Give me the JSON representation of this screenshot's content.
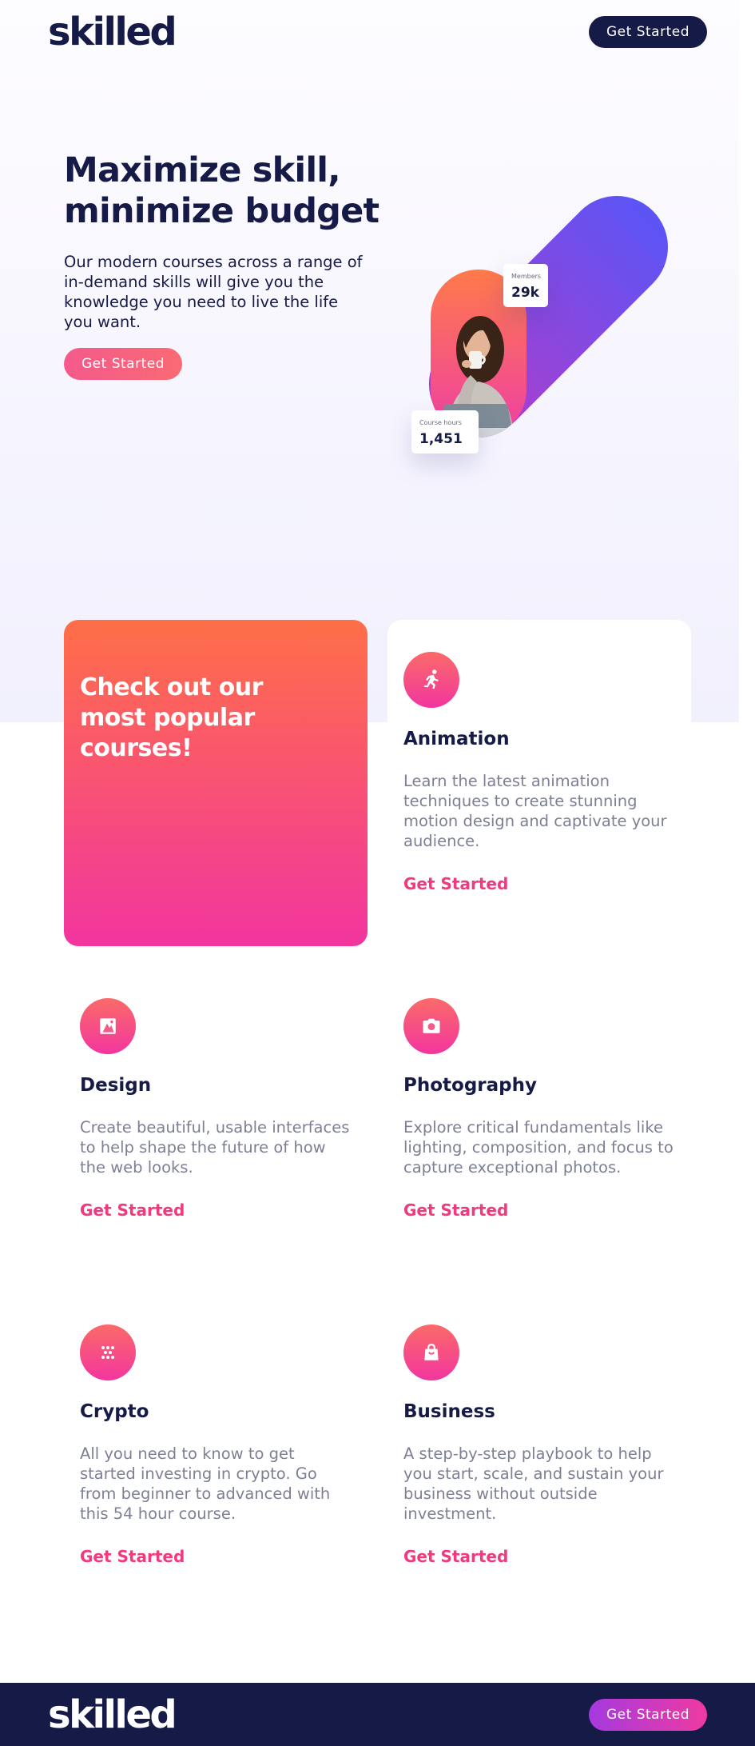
{
  "brand": {
    "logo": "skilled"
  },
  "header": {
    "cta_label": "Get Started"
  },
  "hero": {
    "title": "Maximize skill, minimize budget",
    "text": "Our modern courses across a range of in-demand skills will give you the knowledge you need to live the life you want.",
    "cta_label": "Get Started",
    "stats": [
      {
        "label": "Members",
        "value": "29k"
      },
      {
        "label": "Course hours",
        "value": "1,451"
      }
    ]
  },
  "courses": {
    "promo_text": "Check out our most popular courses!",
    "items": [
      {
        "title": "Animation",
        "icon": "running-person-icon",
        "description": "Learn the latest animation techniques to create stunning motion design and captivate your audience.",
        "cta_label": "Get Started"
      },
      {
        "title": "Design",
        "icon": "image-frame-icon",
        "description": "Create beautiful, usable interfaces to help shape the future of how the web looks.",
        "cta_label": "Get Started"
      },
      {
        "title": "Photography",
        "icon": "camera-icon",
        "description": "Explore critical fundamentals like lighting, composition, and focus to capture exceptional photos.",
        "cta_label": "Get Started"
      },
      {
        "title": "Crypto",
        "icon": "crypto-dots-icon",
        "description": "All you need to know to get started investing in crypto. Go from beginner to advanced with this 54 hour course.",
        "cta_label": "Get Started"
      },
      {
        "title": "Business",
        "icon": "shopping-bag-icon",
        "description": "A step-by-step playbook to help you start, scale, and sustain your business without outside investment.",
        "cta_label": "Get Started"
      }
    ]
  },
  "footer": {
    "logo": "skilled",
    "cta_label": "Get Started"
  },
  "colors": {
    "navy": "#161a47",
    "pink": "#f0397e",
    "orange": "#ff6f48",
    "purple": "#5b54f6",
    "muted_text": "#7d8095"
  }
}
